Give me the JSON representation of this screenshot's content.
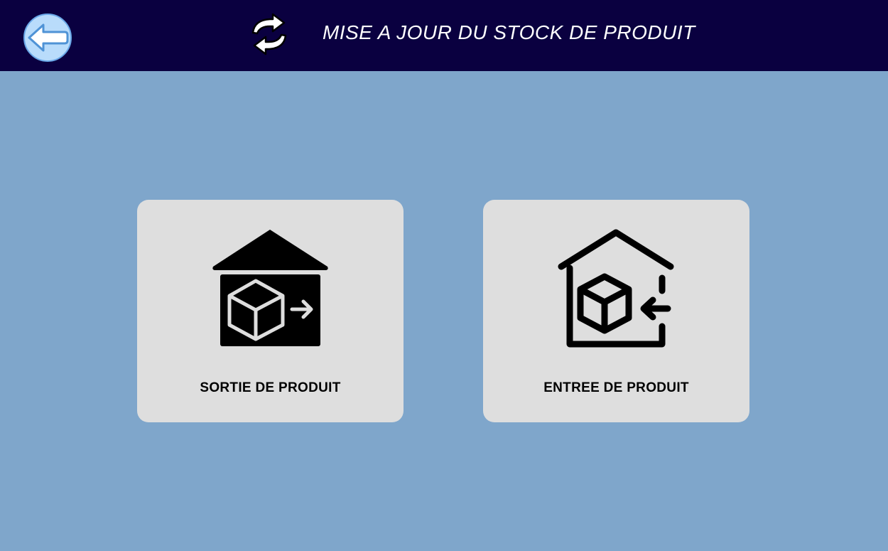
{
  "header": {
    "title": "MISE A JOUR DU STOCK DE PRODUIT",
    "back_icon": "back-arrow-icon",
    "refresh_icon": "refresh-icon"
  },
  "actions": [
    {
      "label": "SORTIE DE PRODUIT",
      "icon": "warehouse-box-out-icon"
    },
    {
      "label": "ENTREE DE PRODUIT",
      "icon": "warehouse-box-in-icon"
    }
  ],
  "colors": {
    "header_bg": "#0a0040",
    "page_bg": "#7fa6cb",
    "card_bg": "#dedede",
    "back_button_fill": "#b9dcfb"
  }
}
